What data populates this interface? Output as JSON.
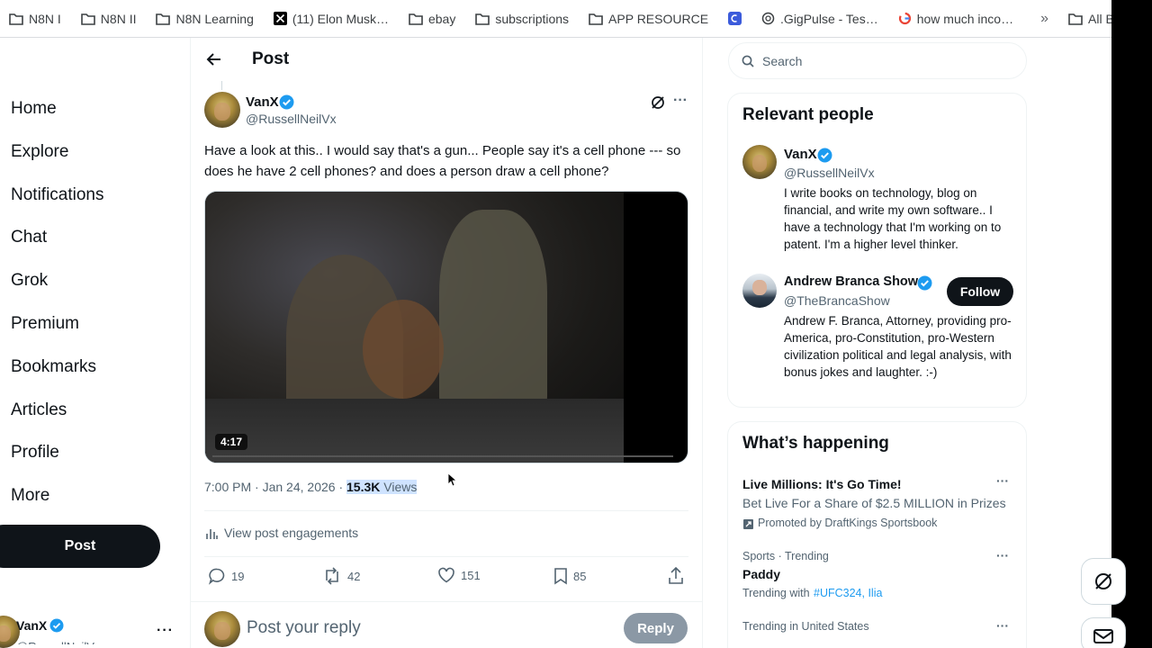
{
  "bookmarks": [
    {
      "label": "N8N I",
      "icon": "folder-icon"
    },
    {
      "label": "N8N II",
      "icon": "folder-icon"
    },
    {
      "label": "N8N Learning",
      "icon": "folder-icon"
    },
    {
      "label": "(11) Elon Musk…",
      "icon": "x-logo-icon"
    },
    {
      "label": "ebay",
      "icon": "folder-icon"
    },
    {
      "label": "subscriptions",
      "icon": "folder-icon"
    },
    {
      "label": "APP RESOURCE",
      "icon": "folder-icon"
    },
    {
      "label": "",
      "icon": "app-icon"
    },
    {
      "label": ".GigPulse - Tes…",
      "icon": "openai-icon"
    },
    {
      "label": "how much inco…",
      "icon": "google-icon"
    }
  ],
  "bookmarks_more": "»",
  "bookmarks_all": "All Book",
  "nav": [
    "Home",
    "Explore",
    "Notifications",
    "Chat",
    "Grok",
    "Premium",
    "Bookmarks",
    "Articles",
    "Profile",
    "More"
  ],
  "post_button": "Post",
  "sidebar_user": {
    "name": "VanX",
    "handle": "@RussellNeilVx"
  },
  "header": {
    "title": "Post"
  },
  "tweet": {
    "author": "VanX",
    "handle": "@RussellNeilVx",
    "text": "Have a look at this.. I would say that's a gun... People say it's a cell phone --- so does he have 2 cell phones? and does a person draw a cell phone?",
    "video_duration": "4:17",
    "time": "7:00 PM",
    "date": "Jan 24, 2026",
    "views_count": "15.3K",
    "views_label": "Views",
    "engagements": "View post engagements",
    "replies": "19",
    "reposts": "42",
    "likes": "151",
    "bookmarks": "85"
  },
  "reply": {
    "placeholder": "Post your reply",
    "button": "Reply"
  },
  "search": {
    "placeholder": "Search"
  },
  "relevant": {
    "title": "Relevant people",
    "people": [
      {
        "name": "VanX",
        "handle": "@RussellNeilVx",
        "bio": "I write books on technology, blog on financial, and write my own software.. I have a technology that I'm working on to patent. I'm a higher level thinker."
      },
      {
        "name": "Andrew Branca Show",
        "handle": "@TheBrancaShow",
        "bio": "Andrew F. Branca, Attorney, providing pro-America, pro-Constitution, pro-Western civilization political and legal analysis, with bonus jokes and laughter. :-)",
        "follow": "Follow"
      }
    ]
  },
  "happening": {
    "title": "What’s happening",
    "items": [
      {
        "title": "Live Millions: It's Go Time!",
        "desc": "Bet Live For a Share of $2.5 MILLION in Prizes",
        "promo": "Promoted by DraftKings Sportsbook"
      },
      {
        "context": "Sports · Trending",
        "title": "Paddy",
        "trending_prefix": "Trending with",
        "tags": "#UFC324, Ilia"
      },
      {
        "context": "Trending in United States"
      }
    ]
  },
  "colors": {
    "accent": "#1d9bf0",
    "text": "#0f1419",
    "muted": "#536471",
    "verified": "#1d9bf0"
  }
}
